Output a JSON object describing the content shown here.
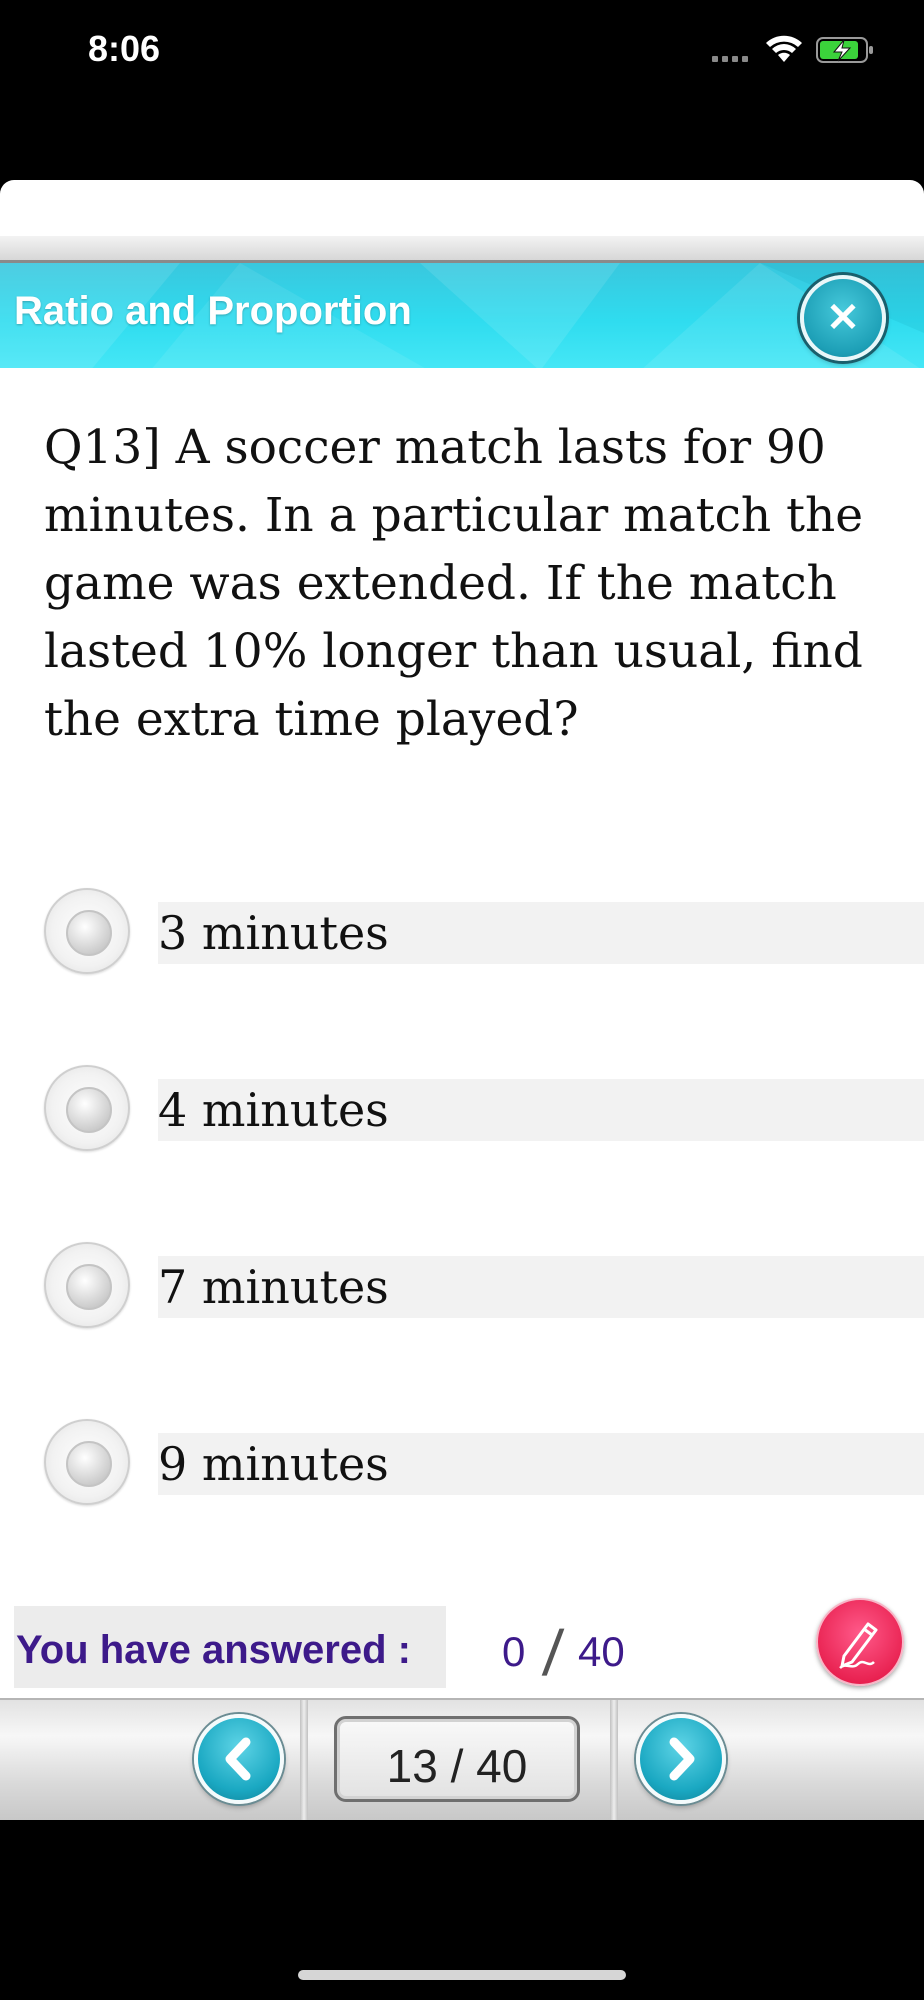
{
  "status_bar": {
    "time": "8:06",
    "signal_icon": "signal-dots-icon",
    "wifi_icon": "wifi-icon",
    "battery_icon": "battery-charging-icon"
  },
  "header": {
    "title": "Ratio and Proportion",
    "close_icon": "close-icon",
    "accent_color": "#2fdcef"
  },
  "question": {
    "text": "Q13]    A soccer match lasts for 90 minutes.  In a particular match the game was extended.  If the match lasted 10% longer than usual, find the extra time played?"
  },
  "options": [
    {
      "label": "3 minutes",
      "selected": false
    },
    {
      "label": "4 minutes",
      "selected": false
    },
    {
      "label": "7 minutes",
      "selected": false
    },
    {
      "label": "9 minutes",
      "selected": false
    }
  ],
  "progress": {
    "label": "You have answered :",
    "answered": "0",
    "separator": "/",
    "total": "40",
    "label_color": "#3d1a8a"
  },
  "notes_button": {
    "icon": "pen-icon",
    "color": "#e8204f"
  },
  "navigation": {
    "prev_icon": "chevron-left-icon",
    "next_icon": "chevron-right-icon",
    "page_indicator": "13 / 40"
  }
}
